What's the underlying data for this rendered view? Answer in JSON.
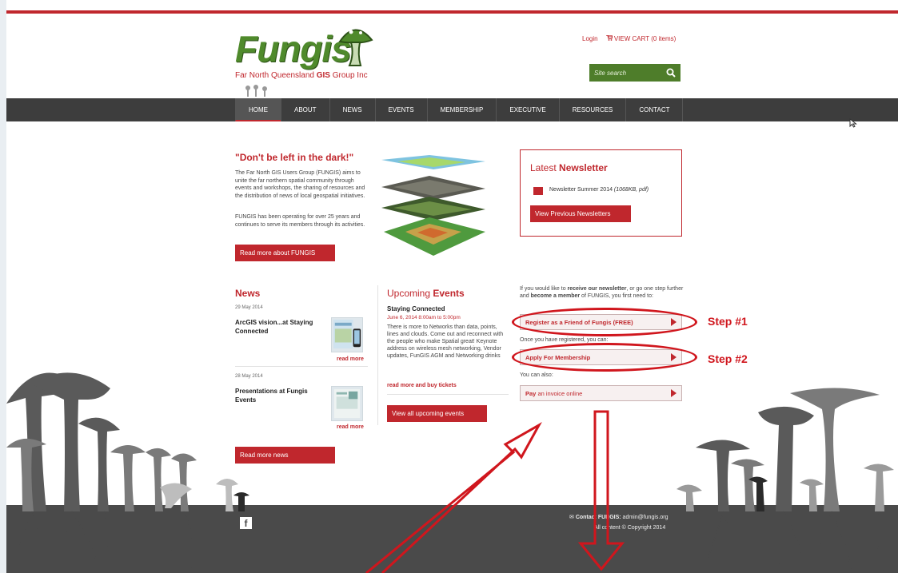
{
  "header": {
    "logo_text": "Fungis",
    "tagline_prefix": "Far North Queensland ",
    "tagline_bold": "GIS",
    "tagline_suffix": " Group Inc",
    "login": "Login",
    "cart": "VIEW CART (0 items)",
    "search_placeholder": "Site search"
  },
  "nav": {
    "items": [
      "HOME",
      "ABOUT",
      "NEWS",
      "EVENTS",
      "MEMBERSHIP",
      "EXECUTIVE",
      "RESOURCES",
      "CONTACT"
    ],
    "active": "HOME"
  },
  "intro": {
    "title": "\"Don't be left in the dark!\"",
    "p1": "The Far North GIS Users Group (FUNGIS) aims to unite the far northern spatial community through events and workshops, the sharing of resources and the distribution of news of local geospatial initiatives.",
    "p2": "FUNGIS has been operating for over 25 years and continues to serve its members through its activities.",
    "button": "Read more about FUNGIS"
  },
  "newsletter": {
    "title_prefix": "Latest ",
    "title_bold": "Newsletter",
    "item_name": "Newsletter Summer 2014 ",
    "item_meta": "(1068KB, pdf)",
    "button": "View Previous Newsletters"
  },
  "news": {
    "title": "News",
    "items": [
      {
        "date": "29 May 2014",
        "headline": "ArcGIS vision...at Staying Connected",
        "read_more": "read more"
      },
      {
        "date": "28 May 2014",
        "headline": "Presentations at Fungis Events",
        "read_more": "read more"
      }
    ],
    "button": "Read more news"
  },
  "events": {
    "title_prefix": "Upcoming ",
    "title_bold": "Events",
    "event_title": "Staying Connected",
    "event_date": "June 6, 2014 8:00am to 5:00pm",
    "event_desc": "There is more to Networks than data, points, lines and clouds. Come out and reconnect with the people who make Spatial great! Keynote address on wireless mesh networking, Vendor updates, FunGIS AGM and Networking drinks",
    "event_link": "read more and buy tickets",
    "button": "View all upcoming events"
  },
  "membership": {
    "intro": "If you would like to receive our newsletter, or go one step further and become a member of FUNGIS, you first need to:",
    "register": "Register as a Friend of Fungis (FREE)",
    "once": "Once you have registered, you can:",
    "apply": "Apply For Membership",
    "also": "You can also:",
    "pay_bold": "Pay",
    "pay_rest": " an invoice online"
  },
  "annotations": {
    "step1": "Step #1",
    "step2": "Step #2",
    "color": "#d0161d"
  },
  "footer": {
    "contact_label": "Contact FUNGIS:",
    "contact_email": "admin@fungis.org",
    "copyright": "All content © Copyright 2014",
    "facebook": "f"
  },
  "colors": {
    "brand_red": "#c0272d",
    "brand_green": "#4e7d2a",
    "nav_bg": "#3d3d3d",
    "footer_bg": "#4a4a4a"
  }
}
